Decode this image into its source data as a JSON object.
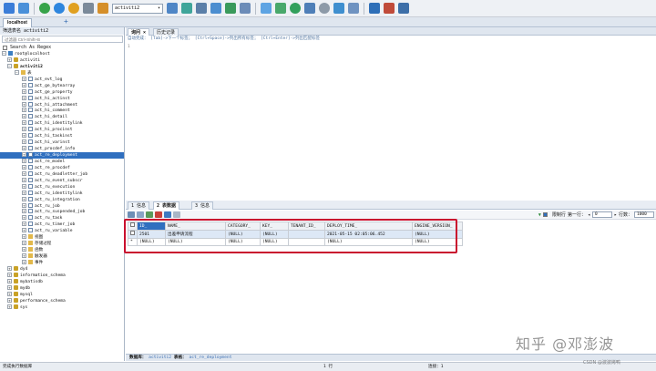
{
  "toolbar": {
    "db_select": "activiti2"
  },
  "conn_tab": "localhost",
  "add_tab": "+",
  "left": {
    "filter_label": "筛选表名 activiti2",
    "filter_placeholder": "过滤器 Ctrl+Shift+B",
    "search_exact": "Search As Regex",
    "tree": [
      {
        "text": "root@localhost",
        "icon": "srv",
        "exp": "⊟"
      },
      {
        "text": "activiti",
        "icon": "db",
        "exp": "⊞"
      },
      {
        "text": "activiti2",
        "icon": "db",
        "exp": "⊟"
      },
      {
        "text": "表",
        "icon": "fold",
        "exp": "⊟"
      },
      {
        "text": "act_evt_log",
        "icon": "tbl",
        "exp": "⊞"
      },
      {
        "text": "act_ge_bytearray",
        "icon": "tbl",
        "exp": "⊞"
      },
      {
        "text": "act_ge_property",
        "icon": "tbl",
        "exp": "⊞"
      },
      {
        "text": "act_hi_actinst",
        "icon": "tbl",
        "exp": "⊞"
      },
      {
        "text": "act_hi_attachment",
        "icon": "tbl",
        "exp": "⊞"
      },
      {
        "text": "act_hi_comment",
        "icon": "tbl",
        "exp": "⊞"
      },
      {
        "text": "act_hi_detail",
        "icon": "tbl",
        "exp": "⊞"
      },
      {
        "text": "act_hi_identitylink",
        "icon": "tbl",
        "exp": "⊞"
      },
      {
        "text": "act_hi_procinst",
        "icon": "tbl",
        "exp": "⊞"
      },
      {
        "text": "act_hi_taskinst",
        "icon": "tbl",
        "exp": "⊞"
      },
      {
        "text": "act_hi_varinst",
        "icon": "tbl",
        "exp": "⊞"
      },
      {
        "text": "act_procdef_info",
        "icon": "tbl",
        "exp": "⊞"
      },
      {
        "text": "act_re_deployment",
        "icon": "tbl",
        "exp": "⊞"
      },
      {
        "text": "act_re_model",
        "icon": "tbl",
        "exp": "⊞"
      },
      {
        "text": "act_re_procdef",
        "icon": "tbl",
        "exp": "⊞"
      },
      {
        "text": "act_ru_deadletter_job",
        "icon": "tbl",
        "exp": "⊞"
      },
      {
        "text": "act_ru_event_subscr",
        "icon": "tbl",
        "exp": "⊞"
      },
      {
        "text": "act_ru_execution",
        "icon": "tbl",
        "exp": "⊞"
      },
      {
        "text": "act_ru_identitylink",
        "icon": "tbl",
        "exp": "⊞"
      },
      {
        "text": "act_ru_integration",
        "icon": "tbl",
        "exp": "⊞"
      },
      {
        "text": "act_ru_job",
        "icon": "tbl",
        "exp": "⊞"
      },
      {
        "text": "act_ru_suspended_job",
        "icon": "tbl",
        "exp": "⊞"
      },
      {
        "text": "act_ru_task",
        "icon": "tbl",
        "exp": "⊞"
      },
      {
        "text": "act_ru_timer_job",
        "icon": "tbl",
        "exp": "⊞"
      },
      {
        "text": "act_ru_variable",
        "icon": "tbl",
        "exp": "⊞"
      },
      {
        "text": "视图",
        "icon": "fold",
        "exp": "⊞"
      },
      {
        "text": "存储过程",
        "icon": "fold",
        "exp": "⊞"
      },
      {
        "text": "函数",
        "icon": "fold",
        "exp": "⊞"
      },
      {
        "text": "触发器",
        "icon": "fold",
        "exp": "⊞"
      },
      {
        "text": "事件",
        "icon": "fold",
        "exp": "⊞"
      },
      {
        "text": "dy4",
        "icon": "db",
        "exp": "⊞"
      },
      {
        "text": "information_schema",
        "icon": "db",
        "exp": "⊞"
      },
      {
        "text": "mybatisdb",
        "icon": "db",
        "exp": "⊞"
      },
      {
        "text": "mydb",
        "icon": "db",
        "exp": "⊞"
      },
      {
        "text": "mysql",
        "icon": "db",
        "exp": "⊞"
      },
      {
        "text": "performance_schema",
        "icon": "db",
        "exp": "⊞"
      },
      {
        "text": "sys",
        "icon": "db",
        "exp": "⊞"
      }
    ]
  },
  "query_tabs": {
    "query": "询问",
    "history": "历史记录"
  },
  "hint": {
    "prefix": "自动完成：",
    "tab": "[Tab]->下一个标签；",
    "ctrl_space": "[Ctrl+Space]->列出所有标签；",
    "ctrl_enter": "[Ctrl+Enter]->列出匹配标签"
  },
  "editor_line": "1",
  "result_tabs": {
    "info": "1 信息",
    "tabledata": "2 表数据",
    "messages": "3 信息"
  },
  "result_tool": {
    "limit_label": "限制行",
    "first_row_label": "第一行：",
    "first_row": "0",
    "rows_label": "行数：",
    "rows": "1000"
  },
  "grid": {
    "columns": [
      "ID_",
      "NAME_",
      "CATEGORY_",
      "KEY_",
      "TENANT_ID_",
      "DEPLOY_TIME_",
      "ENGINE_VERSION_"
    ],
    "rows": [
      [
        "2501",
        "出差申请流程",
        "(NULL)",
        "(NULL)",
        "",
        "2021-05-15 02:05:06.452",
        "(NULL)"
      ],
      [
        "(NULL)",
        "(NULL)",
        "(NULL)",
        "(NULL)",
        "",
        "(NULL)",
        "(NULL)"
      ]
    ]
  },
  "bottom": {
    "db_label": "数据库：",
    "db": "activiti2",
    "table_label": "表格：",
    "table": "act_re_deployment"
  },
  "status": {
    "left": "完成执行数据库",
    "rows": "1 行",
    "conn": "连接：1"
  },
  "watermark": "知乎 @邓澎波",
  "watermark2": "CSDN @波波烤鸭"
}
